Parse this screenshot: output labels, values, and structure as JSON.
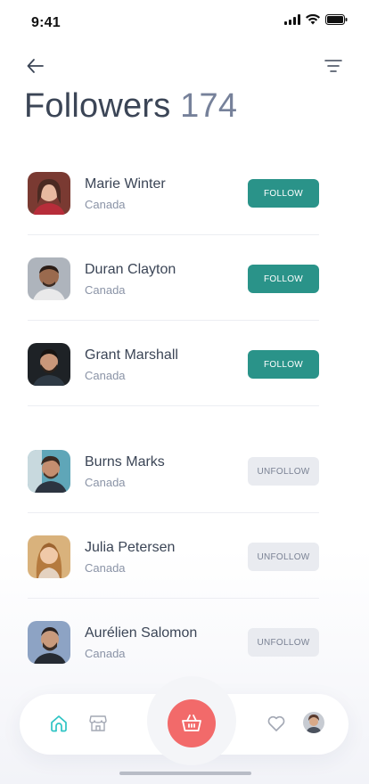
{
  "status_bar": {
    "time": "9:41"
  },
  "header": {
    "title": "Followers",
    "count": "174"
  },
  "people": [
    {
      "name": "Marie Winter",
      "country": "Canada",
      "action": "FOLLOW",
      "state": "follow"
    },
    {
      "name": "Duran Clayton",
      "country": "Canada",
      "action": "FOLLOW",
      "state": "follow"
    },
    {
      "name": "Grant Marshall",
      "country": "Canada",
      "action": "FOLLOW",
      "state": "follow"
    },
    {
      "name": "Burns Marks",
      "country": "Canada",
      "action": "UNFOLLOW",
      "state": "unfollow"
    },
    {
      "name": "Julia Petersen",
      "country": "Canada",
      "action": "UNFOLLOW",
      "state": "unfollow"
    },
    {
      "name": "Aurélien Salomon",
      "country": "Canada",
      "action": "UNFOLLOW",
      "state": "unfollow"
    }
  ],
  "colors": {
    "follow": "#2a9389",
    "unfollow": "#e9ebf0",
    "cart": "#f26a6a",
    "active_nav": "#2ec4c4"
  },
  "icons": {
    "back": "arrow-left-icon",
    "filter": "filter-icon",
    "home": "home-icon",
    "store": "store-icon",
    "cart": "basket-icon",
    "favorites": "heart-icon"
  }
}
